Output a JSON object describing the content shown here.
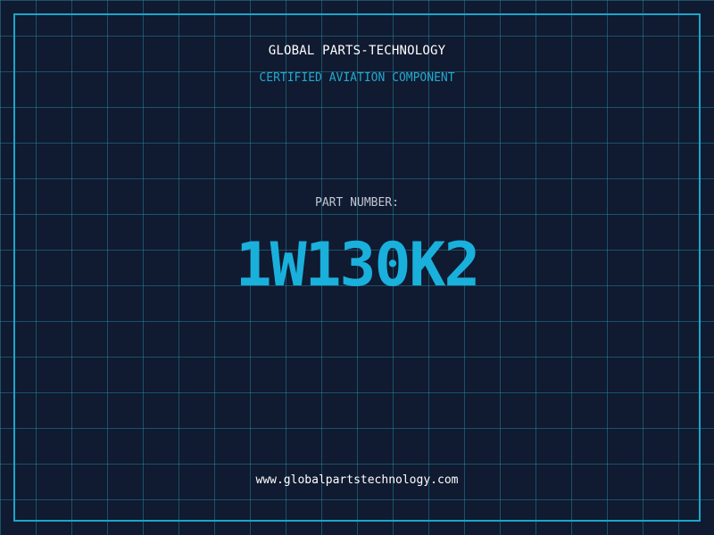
{
  "header": {
    "brand": "GLOBAL PARTS-TECHNOLOGY",
    "tagline": "CERTIFIED AVIATION COMPONENT"
  },
  "part": {
    "label": "PART NUMBER:",
    "number": "1W130K2"
  },
  "footer": {
    "website": "www.globalpartstechnology.com"
  },
  "colors": {
    "background": "#101a30",
    "grid": "#2696af",
    "frame": "#19a6c8",
    "accent": "#1ab0dc",
    "label": "#c0c6d2",
    "text": "#ffffff"
  }
}
